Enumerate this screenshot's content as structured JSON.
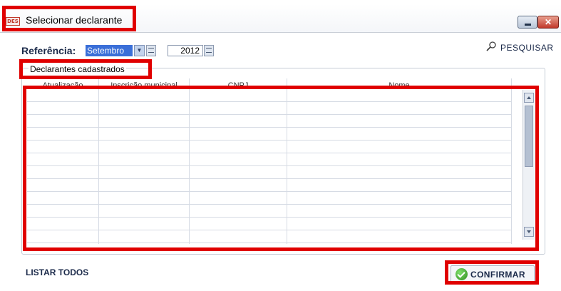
{
  "window": {
    "title": "Selecionar declarante",
    "app_icon_text": "DES"
  },
  "reference": {
    "label": "Referência:",
    "month": "Setembro",
    "year": "2012"
  },
  "search": {
    "label": "PESQUISAR",
    "icon": "search-icon"
  },
  "group": {
    "title": "Declarantes cadastrados"
  },
  "table": {
    "columns": [
      "Atualização",
      "Inscrição municipal",
      "CNPJ",
      "Nome"
    ],
    "rows": []
  },
  "footer": {
    "list_all_label": "LISTAR TODOS",
    "confirm_label": "CONFIRMAR"
  },
  "colors": {
    "highlight": "#e00000",
    "selection": "#3a6fd8",
    "confirm_icon": "#2f8a1e"
  }
}
